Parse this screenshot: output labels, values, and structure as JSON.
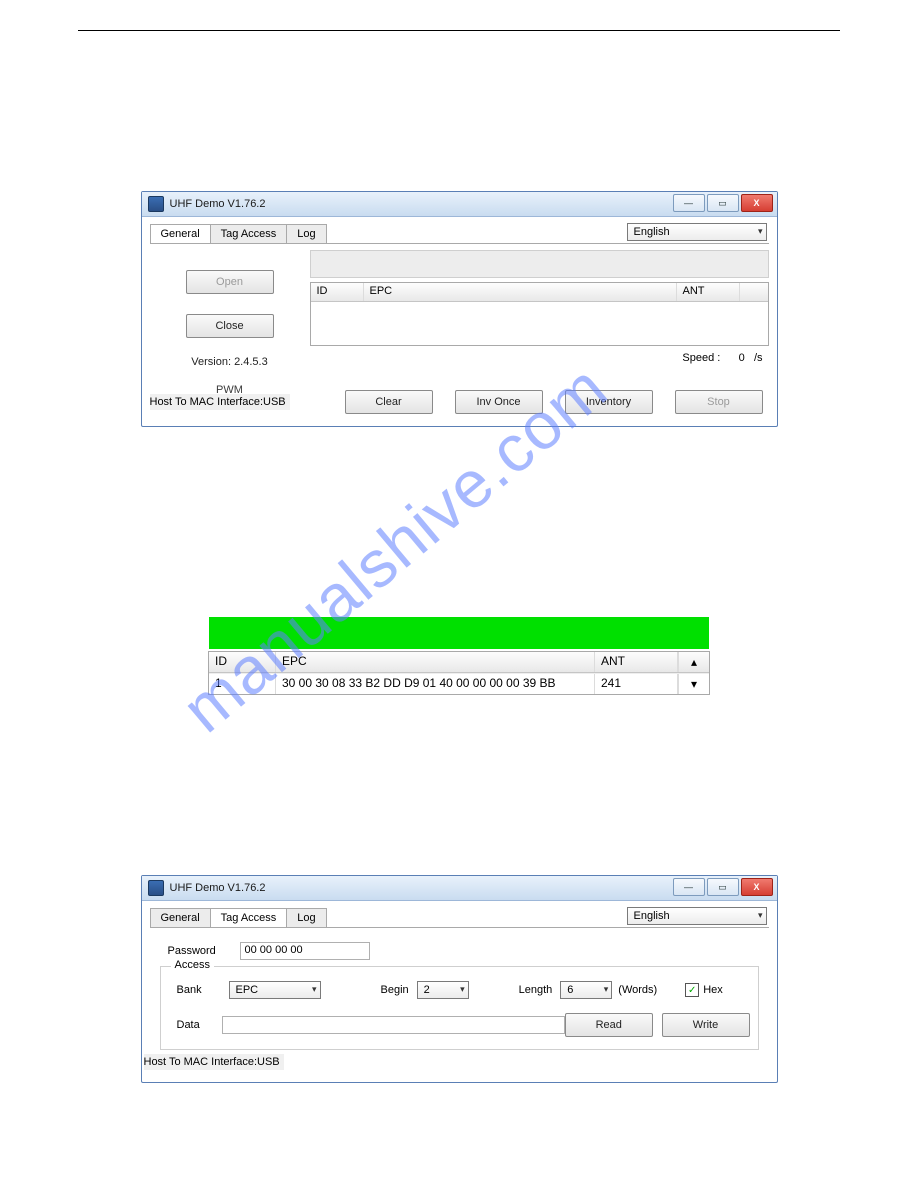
{
  "watermark": "manualshive.com",
  "window_general": {
    "title": "UHF Demo V1.76.2",
    "tabs": [
      "General",
      "Tag Access",
      "Log"
    ],
    "active_tab": 0,
    "language": "English",
    "buttons": {
      "open": "Open",
      "close": "Close",
      "clear": "Clear",
      "inv_once": "Inv Once",
      "inventory": "Inventory",
      "stop": "Stop"
    },
    "version_label": "Version: 2.4.5.3",
    "pwm_label": "PWM",
    "host_line": "Host To MAC Interface:USB",
    "list_headers": {
      "id": "ID",
      "epc": "EPC",
      "ant": "ANT"
    },
    "speed_label": "Speed :",
    "speed_value": "0",
    "speed_unit": "/s"
  },
  "mid_table": {
    "headers": {
      "id": "ID",
      "epc": "EPC",
      "ant": "ANT"
    },
    "rows": [
      {
        "id": "1",
        "epc": "30 00 30 08 33 B2 DD D9 01 40 00 00 00 00 39 BB",
        "ant": "241"
      }
    ]
  },
  "window_access": {
    "title": "UHF Demo V1.76.2",
    "tabs": [
      "General",
      "Tag Access",
      "Log"
    ],
    "active_tab": 1,
    "language": "English",
    "password_label": "Password",
    "password_value": "00 00 00 00",
    "group_title": "Access",
    "bank_label": "Bank",
    "bank_value": "EPC",
    "begin_label": "Begin",
    "begin_value": "2",
    "length_label": "Length",
    "length_value": "6",
    "words_label": "(Words)",
    "hex_label": "Hex",
    "hex_checked": true,
    "data_label": "Data",
    "data_value": "",
    "buttons": {
      "read": "Read",
      "write": "Write"
    },
    "host_line": "Host To MAC Interface:USB"
  }
}
